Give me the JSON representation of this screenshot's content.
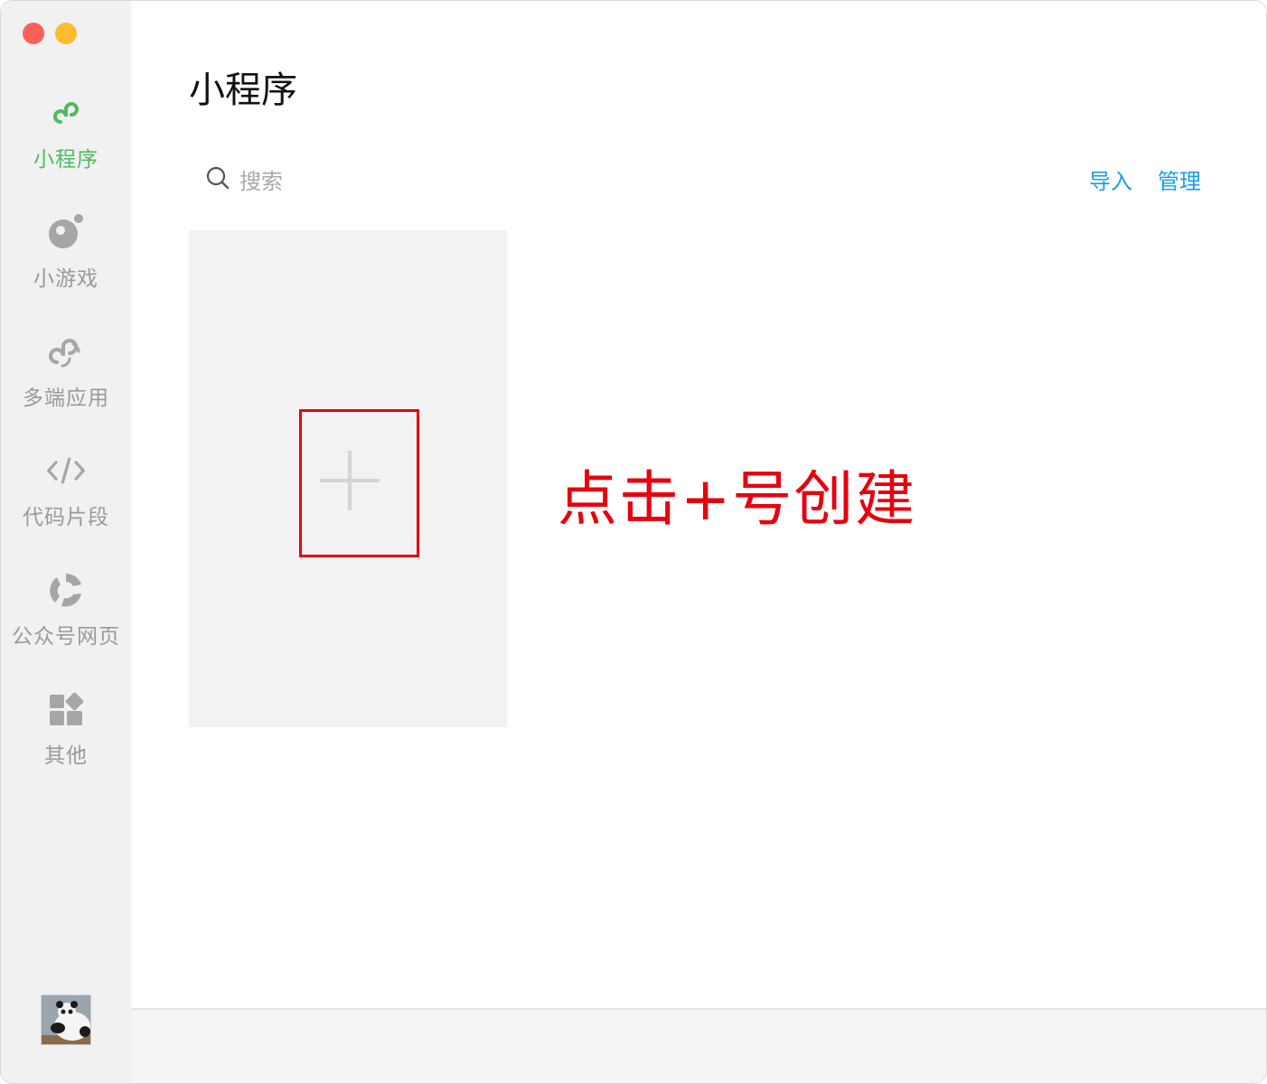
{
  "window": {
    "traffic_lights": [
      "close",
      "minimize"
    ]
  },
  "sidebar": {
    "items": [
      {
        "label": "小程序",
        "icon": "miniprogram-icon",
        "active": true
      },
      {
        "label": "小游戏",
        "icon": "minigame-icon",
        "active": false
      },
      {
        "label": "多端应用",
        "icon": "multiplatform-icon",
        "active": false
      },
      {
        "label": "代码片段",
        "icon": "code-snippet-icon",
        "active": false
      },
      {
        "label": "公众号网页",
        "icon": "official-account-icon",
        "active": false
      },
      {
        "label": "其他",
        "icon": "other-apps-icon",
        "active": false
      }
    ],
    "avatar": "panda-avatar"
  },
  "main": {
    "title": "小程序",
    "search": {
      "placeholder": "搜索"
    },
    "actions": {
      "import_label": "导入",
      "manage_label": "管理"
    },
    "annotation": "点击+号创建"
  },
  "colors": {
    "accent_green": "#4fba61",
    "link_blue": "#1a9de6",
    "annotation_red": "#e8000e"
  }
}
